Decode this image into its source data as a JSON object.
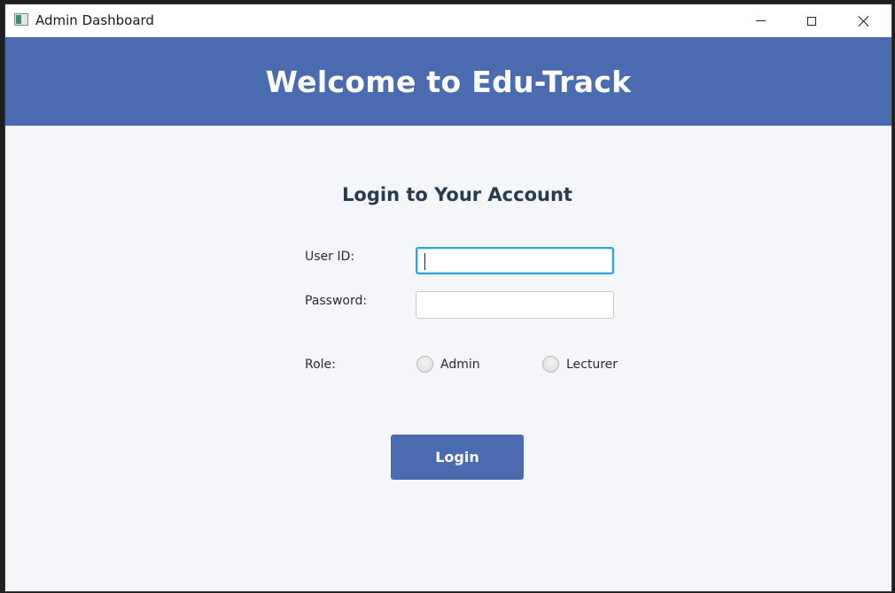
{
  "window": {
    "title": "Admin Dashboard"
  },
  "header": {
    "title": "Welcome to Edu-Track"
  },
  "login": {
    "heading": "Login to Your Account",
    "user_id_label": "User ID:",
    "user_id_value": "",
    "password_label": "Password:",
    "password_value": "",
    "role_label": "Role:",
    "role_options": [
      "Admin",
      "Lecturer"
    ],
    "selected_role": "",
    "submit_label": "Login"
  },
  "colors": {
    "accent": "#4a6baf",
    "background": "#f5f6fa",
    "heading_text": "#283a4d",
    "focus_border": "#2aa3d8"
  },
  "icons": {
    "app": "app-window-icon",
    "minimize": "minimize-icon",
    "maximize": "maximize-icon",
    "close": "close-icon"
  }
}
